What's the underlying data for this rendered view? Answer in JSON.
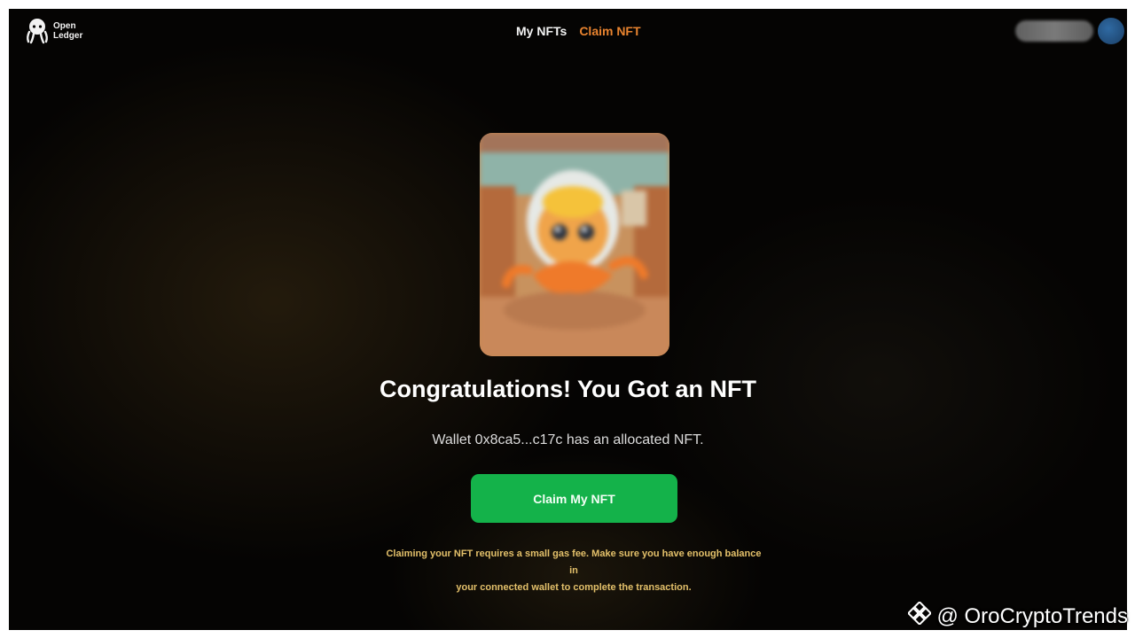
{
  "brand": {
    "name_line1": "Open",
    "name_line2": "Ledger",
    "logo_icon": "octopus-icon"
  },
  "nav": {
    "items": [
      {
        "label": "My NFTs",
        "active": false
      },
      {
        "label": "Claim NFT",
        "active": true
      }
    ],
    "active_color": "#e8832f"
  },
  "header": {
    "avatar_color": "#2f6aa3"
  },
  "main": {
    "title": "Congratulations! You Got an NFT",
    "subtitle": "Wallet 0x8ca5...c17c has an allocated NFT.",
    "claim_button": "Claim My NFT",
    "claim_button_color": "#14b24a",
    "note_line1": "Claiming your NFT requires a small gas fee. Make sure you have enough balance in",
    "note_line2": "your connected wallet to complete the transaction."
  },
  "watermark": {
    "text": "@ OroCryptoTrends",
    "icon": "binance-square-icon"
  }
}
